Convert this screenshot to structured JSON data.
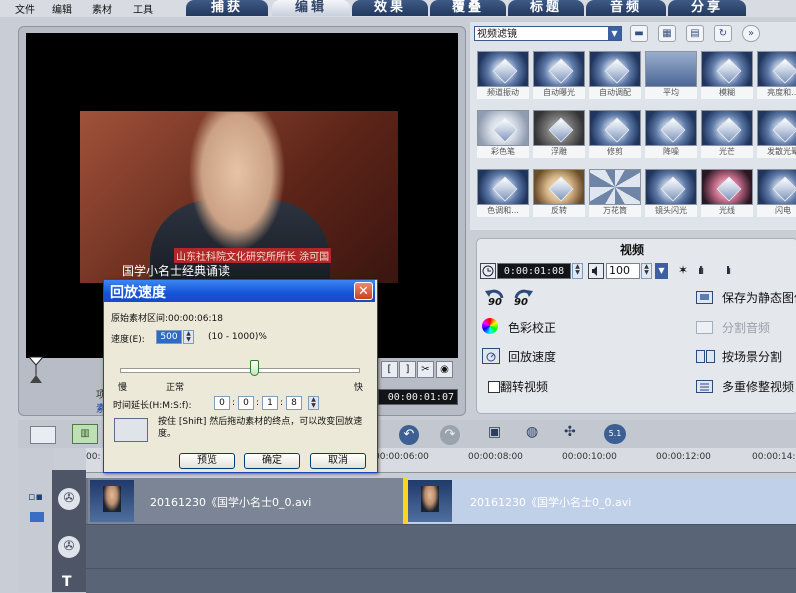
{
  "menu": [
    "文件",
    "编辑",
    "素材",
    "工具"
  ],
  "tabs": [
    {
      "label": "捕获",
      "active": false
    },
    {
      "label": "编辑",
      "active": true
    },
    {
      "label": "效果",
      "active": false
    },
    {
      "label": "覆叠",
      "active": false
    },
    {
      "label": "标题",
      "active": false
    },
    {
      "label": "音频",
      "active": false
    },
    {
      "label": "分享",
      "active": false
    }
  ],
  "preview": {
    "caption_red": "山东社科院文化研究所所长 涂可国",
    "caption_white": "国学小名士经典诵读",
    "timecode": "00:00:01:07",
    "label_left_a": "项",
    "label_left_b": "素"
  },
  "filters": {
    "dropdown_value": "视频滤镜",
    "items": [
      "频道振动",
      "自动曝光",
      "自动调配",
      "平均",
      "模糊",
      "亮度和...",
      "彩色笔",
      "浮雕",
      "修剪",
      "降噪",
      "光芒",
      "发散光晕",
      "色调和...",
      "反转",
      "万花筒",
      "镜头闪光",
      "光线",
      "闪电"
    ]
  },
  "options": {
    "title": "视频",
    "timecode": "0:00:01:08",
    "volume": "100",
    "rotate_left": "90",
    "rotate_right": "90",
    "color_correction": "色彩校正",
    "playback_speed": "回放速度",
    "reverse_video": "翻转视频",
    "save_still": "保存为静态图像",
    "split_audio": "分割音频",
    "split_by_scene": "按场景分割",
    "multi_trim": "多重修整视频"
  },
  "timeline": {
    "ticks": [
      "00:",
      "00:00:06:00",
      "00:00:08:00",
      "00:00:10:00",
      "00:00:12:00",
      "00:00:14:"
    ],
    "clip1_name": "20161230《国学小名士0_0.avi",
    "clip2_name": "20161230《国学小名士0_0.avi"
  },
  "dialog": {
    "title": "回放速度",
    "original_duration": "原始素材区间:00:00:06:18",
    "speed_label": "速度(E):",
    "speed_value": "500",
    "speed_range": "(10 - 1000)%",
    "slow": "慢",
    "normal": "正常",
    "fast": "快",
    "time_stretch_label": "时间延长(H:M:S:f):",
    "h": "0",
    "m": "0",
    "s": "1",
    "f": "8",
    "hint": "按住 [Shift] 然后拖动素材的终点，可以改变回放速度。",
    "preview_btn": "预览",
    "ok_btn": "确定",
    "cancel_btn": "取消",
    "slider_fraction": 0.56
  }
}
